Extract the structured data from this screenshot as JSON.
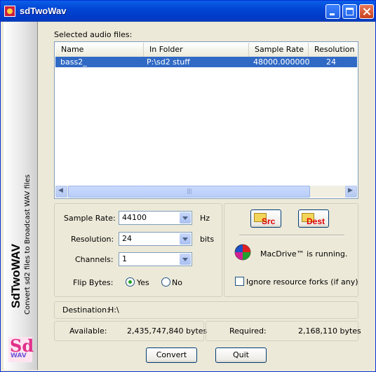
{
  "window": {
    "title": "sdTwoWav"
  },
  "sidebar": {
    "title": "SdTwoWAV",
    "subtitle": "Convert sd2 files to Broadcast WAV files",
    "logo_letters": "Sd",
    "logo_sub": "WAV"
  },
  "files": {
    "label": "Selected audio files:",
    "columns": [
      "Name",
      "In Folder",
      "Sample Rate",
      "Resolution"
    ],
    "rows": [
      {
        "name": "bass2_",
        "folder": "P:\\sd2 stuff",
        "sample_rate": "48000.000000",
        "resolution": "24"
      }
    ],
    "scroll_grip": "||||"
  },
  "settings": {
    "sample_rate_label": "Sample Rate:",
    "sample_rate_value": "44100",
    "sample_rate_unit": "Hz",
    "resolution_label": "Resolution:",
    "resolution_value": "24",
    "resolution_unit": "bits",
    "channels_label": "Channels:",
    "channels_value": "1",
    "flip_label": "Flip Bytes:",
    "flip_yes": "Yes",
    "flip_no": "No",
    "flip_selected": "Yes"
  },
  "tools": {
    "src_label": "Src",
    "dest_label": "Dest",
    "macdrive_status": "MacDrive™ is running.",
    "ignore_forks_label": "Ignore resource forks (if any)",
    "ignore_forks_checked": false
  },
  "destination": {
    "label": "Destination:",
    "value": "H:\\"
  },
  "space": {
    "available_label": "Available:",
    "available_value": "2,435,747,840 bytes",
    "required_label": "Required:",
    "required_value": "2,168,110 bytes"
  },
  "actions": {
    "convert": "Convert",
    "quit": "Quit"
  },
  "colors": {
    "selection": "#316ac5",
    "titlebar": "#0245d4"
  }
}
